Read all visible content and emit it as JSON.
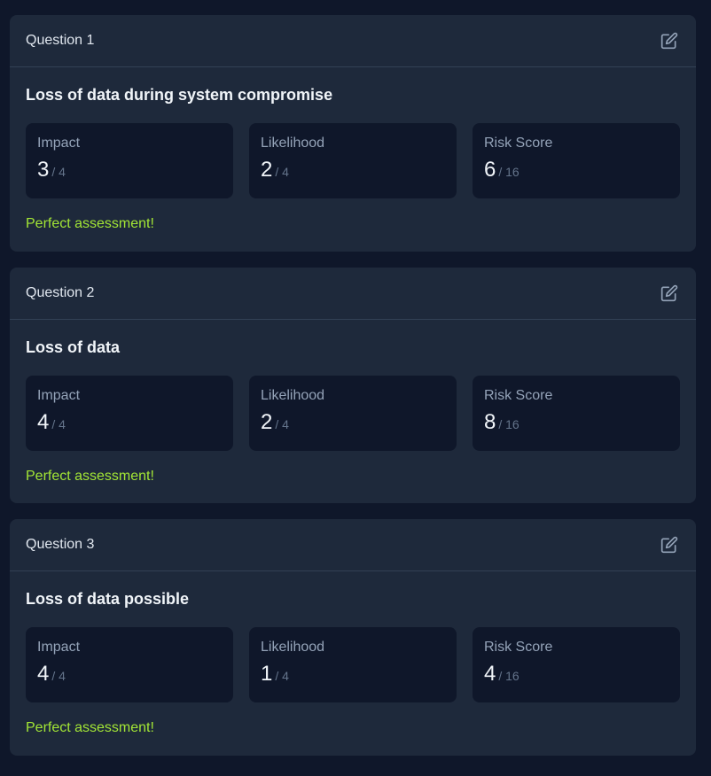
{
  "questions": [
    {
      "label": "Question 1",
      "title": "Loss of data during system compromise",
      "metrics": [
        {
          "label": "Impact",
          "value": "3",
          "max": "/ 4"
        },
        {
          "label": "Likelihood",
          "value": "2",
          "max": "/ 4"
        },
        {
          "label": "Risk Score",
          "value": "6",
          "max": "/ 16"
        }
      ],
      "feedback": "Perfect assessment!",
      "edit_icon": "edit-icon"
    },
    {
      "label": "Question 2",
      "title": "Loss of data",
      "metrics": [
        {
          "label": "Impact",
          "value": "4",
          "max": "/ 4"
        },
        {
          "label": "Likelihood",
          "value": "2",
          "max": "/ 4"
        },
        {
          "label": "Risk Score",
          "value": "8",
          "max": "/ 16"
        }
      ],
      "feedback": "Perfect assessment!",
      "edit_icon": "edit-icon"
    },
    {
      "label": "Question 3",
      "title": "Loss of data possible",
      "metrics": [
        {
          "label": "Impact",
          "value": "4",
          "max": "/ 4"
        },
        {
          "label": "Likelihood",
          "value": "1",
          "max": "/ 4"
        },
        {
          "label": "Risk Score",
          "value": "4",
          "max": "/ 16"
        }
      ],
      "feedback": "Perfect assessment!",
      "edit_icon": "edit-icon"
    }
  ],
  "colors": {
    "page_background": "#0f172a",
    "card_background": "#1e293b",
    "metric_background": "#0f172a",
    "feedback": "#a3e635",
    "muted": "#94a3b8"
  }
}
